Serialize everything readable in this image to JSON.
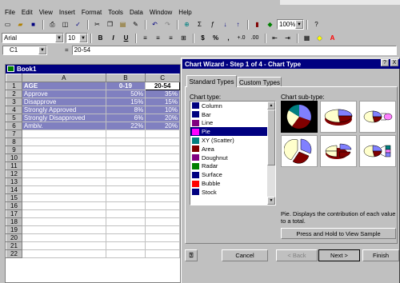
{
  "menu": [
    "File",
    "Edit",
    "View",
    "Insert",
    "Format",
    "Tools",
    "Data",
    "Window",
    "Help"
  ],
  "toolbar": {
    "zoom": "100%",
    "font_name": "Arial",
    "font_size": "10",
    "bold": "B",
    "italic": "I",
    "underline": "U",
    "currency": "$",
    "percent": "%",
    "comma": ","
  },
  "formula_bar": {
    "name_box": "C1",
    "equals": "=",
    "value": "20-54"
  },
  "workbook": {
    "title": "Book1",
    "columns": [
      "A",
      "B",
      "C"
    ],
    "rows": [
      {
        "n": "1",
        "a": "AGE",
        "b": "0-19",
        "c": "20-54"
      },
      {
        "n": "2",
        "a": "Approve",
        "b": "50%",
        "c": "35%"
      },
      {
        "n": "3",
        "a": "Disapprove",
        "b": "15%",
        "c": "15%"
      },
      {
        "n": "4",
        "a": "Strongly Approved",
        "b": "8%",
        "c": "10%"
      },
      {
        "n": "5",
        "a": "Strongly Disapproved",
        "b": "6%",
        "c": "20%"
      },
      {
        "n": "6",
        "a": "Ambiv.",
        "b": "22%",
        "c": "20%"
      },
      {
        "n": "7"
      },
      {
        "n": "8"
      },
      {
        "n": "9"
      },
      {
        "n": "10"
      },
      {
        "n": "11"
      },
      {
        "n": "12"
      },
      {
        "n": "13"
      },
      {
        "n": "14"
      },
      {
        "n": "15"
      },
      {
        "n": "16"
      },
      {
        "n": "17"
      },
      {
        "n": "18"
      },
      {
        "n": "19"
      },
      {
        "n": "20"
      },
      {
        "n": "21"
      },
      {
        "n": "22"
      }
    ]
  },
  "dialog": {
    "title": "Chart Wizard - Step 1 of 4 - Chart Type",
    "help": "?",
    "close": "X",
    "tabs": [
      "Standard Types",
      "Custom Types"
    ],
    "chart_type_label": "Chart type:",
    "sub_type_label": "Chart sub-type:",
    "chart_types": [
      {
        "label": "Column",
        "icon": "column-chart-icon",
        "color": "#000080"
      },
      {
        "label": "Bar",
        "icon": "bar-chart-icon",
        "color": "#000080"
      },
      {
        "label": "Line",
        "icon": "line-chart-icon",
        "color": "#800080"
      },
      {
        "label": "Pie",
        "icon": "pie-chart-icon",
        "color": "#ff00ff"
      },
      {
        "label": "XY (Scatter)",
        "icon": "scatter-chart-icon",
        "color": "#008080"
      },
      {
        "label": "Area",
        "icon": "area-chart-icon",
        "color": "#800000"
      },
      {
        "label": "Doughnut",
        "icon": "doughnut-chart-icon",
        "color": "#800080"
      },
      {
        "label": "Radar",
        "icon": "radar-chart-icon",
        "color": "#008000"
      },
      {
        "label": "Surface",
        "icon": "surface-chart-icon",
        "color": "#000080"
      },
      {
        "label": "Bubble",
        "icon": "bubble-chart-icon",
        "color": "#ff0000"
      },
      {
        "label": "Stock",
        "icon": "stock-chart-icon",
        "color": "#000080"
      }
    ],
    "selected_type": "Pie",
    "description": "Pie. Displays the contribution of each value to a total.",
    "sample_button": "Press and Hold to View Sample",
    "buttons": {
      "cancel": "Cancel",
      "back": "< Back",
      "next": "Next >",
      "finish": "Finish"
    }
  },
  "colors": {
    "title_bar": "#000080",
    "selection": "#8080c0",
    "chrome": "#c0c0c0"
  }
}
